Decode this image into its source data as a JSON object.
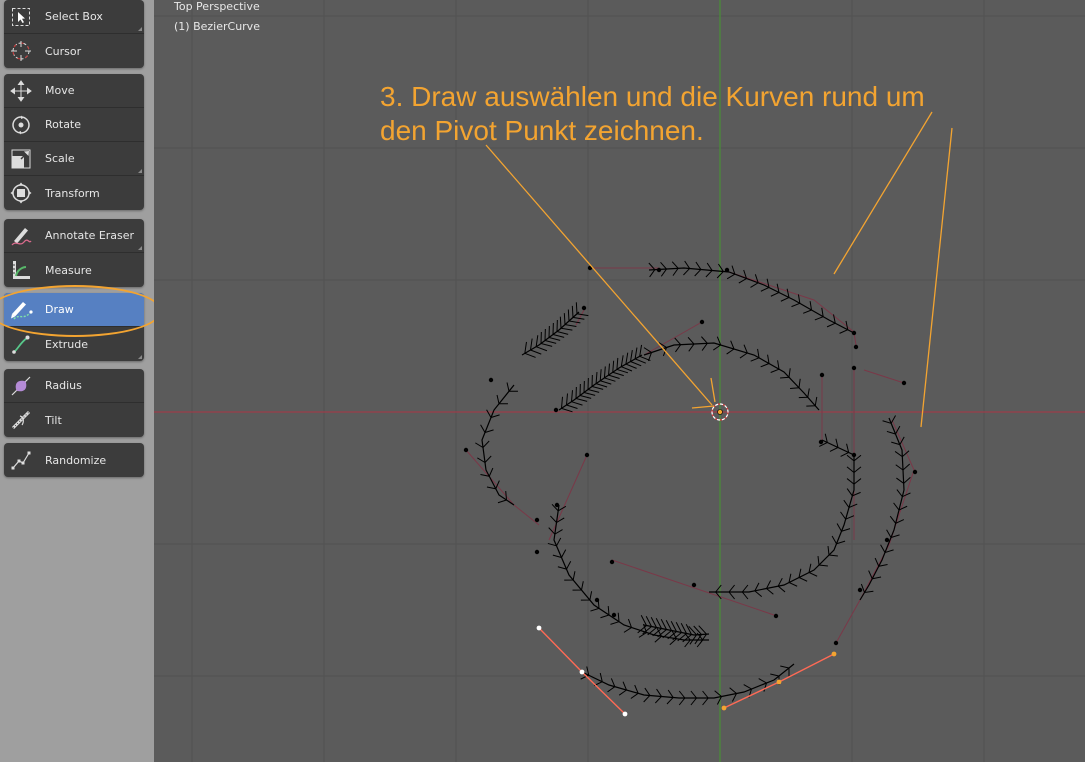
{
  "viewport": {
    "view_name": "Top Perspective",
    "object_name": "(1) BezierCurve"
  },
  "annotation": {
    "line1": "3. Draw auswählen und die Kurven rund um",
    "line2": "den Pivot Punkt zeichnen."
  },
  "toolbar": {
    "select_box": "Select Box",
    "cursor": "Cursor",
    "move": "Move",
    "rotate": "Rotate",
    "scale": "Scale",
    "transform": "Transform",
    "annotate_eraser": "Annotate Eraser",
    "measure": "Measure",
    "draw": "Draw",
    "extrude": "Extrude",
    "radius": "Radius",
    "tilt": "Tilt",
    "randomize": "Randomize"
  },
  "colors": {
    "accent": "#f3a431",
    "active_tool": "#5680c2",
    "x_axis": "#9b3d4a",
    "y_axis": "#4a8a3a"
  },
  "icons": [
    "select-box-icon",
    "cursor-icon",
    "move-icon",
    "rotate-icon",
    "scale-icon",
    "transform-icon",
    "annotate-eraser-icon",
    "measure-icon",
    "draw-icon",
    "extrude-icon",
    "radius-icon",
    "tilt-icon",
    "randomize-icon"
  ]
}
